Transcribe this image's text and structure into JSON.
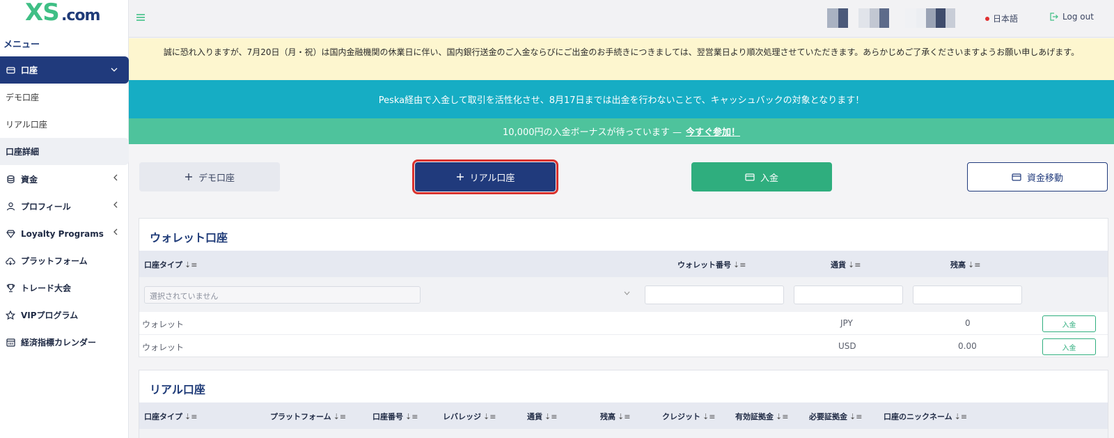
{
  "brand": {
    "logo_main": "XS",
    "logo_suffix": ".com",
    "accent": "#3fbf85",
    "primary": "#203a7c"
  },
  "sidebar": {
    "menu_title": "メニュー",
    "account_group": {
      "label": "口座",
      "icon": "wallet-icon"
    },
    "account_subitems": [
      {
        "label": "デモ口座"
      },
      {
        "label": "リアル口座"
      },
      {
        "label": "口座詳細"
      }
    ],
    "items": [
      {
        "label": "資金",
        "icon": "coins-icon",
        "has_chevron": true
      },
      {
        "label": "プロフィール",
        "icon": "user-icon",
        "has_chevron": true
      },
      {
        "label": "Loyalty Programs",
        "icon": "diamond-icon",
        "has_chevron": true
      },
      {
        "label": "プラットフォーム",
        "icon": "cloud-download-icon",
        "has_chevron": false
      },
      {
        "label": "トレード大会",
        "icon": "trophy-icon",
        "has_chevron": false
      },
      {
        "label": "VIPプログラム",
        "icon": "star-icon",
        "has_chevron": false
      },
      {
        "label": "経済指標カレンダー",
        "icon": "calendar-icon",
        "has_chevron": false
      }
    ]
  },
  "topbar": {
    "language": "日本語",
    "logout": "Log out"
  },
  "notice": "誠に恐れ入りますが、7月20日（月・祝）は国内金融機関の休業日に伴い、国内銀行送金のご入金ならびにご出金のお手続きにつきましては、翌営業日より順次処理させていただきます。あらかじめご了承くださいますようお願い申しあげます。",
  "promo_cashback": "Peska経由で入金して取引を活性化させ、8月17日までは出金を行わないことで、キャッシュバックの対象となります！",
  "promo_bonus": {
    "text": "10,000円の入金ボーナスが待っています —",
    "link": "今すぐ参加！"
  },
  "actions": {
    "demo": "デモ口座",
    "real": "リアル口座",
    "deposit": "入金",
    "transfer": "資金移動"
  },
  "wallet": {
    "title": "ウォレット口座",
    "columns": [
      "口座タイプ",
      "ウォレット番号",
      "通貨",
      "残高"
    ],
    "filter_placeholder": "選択されていません",
    "rows": [
      {
        "type": "ウォレット",
        "currency": "JPY",
        "balance": "0",
        "action": "入金"
      },
      {
        "type": "ウォレット",
        "currency": "USD",
        "balance": "0.00",
        "action": "入金"
      }
    ]
  },
  "real": {
    "title": "リアル口座",
    "columns": [
      "口座タイプ",
      "プラットフォーム",
      "口座番号",
      "レバレッジ",
      "通貨",
      "残高",
      "クレジット",
      "有効証拠金",
      "必要証拠金",
      "口座のニックネーム"
    ]
  }
}
